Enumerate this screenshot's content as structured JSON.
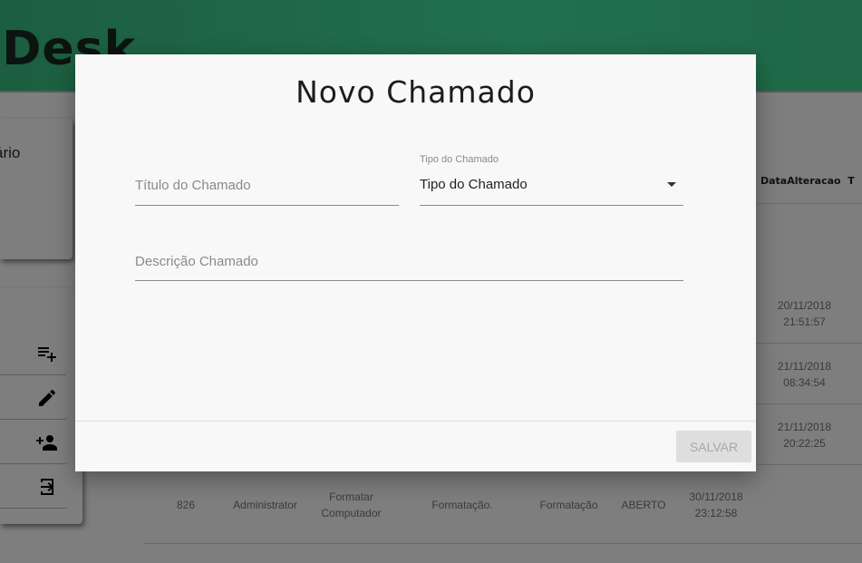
{
  "app": {
    "logo": "eDesk"
  },
  "sidebar": {
    "card_label": "ário",
    "buttons": [
      {
        "icon": "playlist-add-icon"
      },
      {
        "icon": "edit-icon"
      },
      {
        "icon": "person-add-icon"
      },
      {
        "icon": "logout-icon"
      }
    ]
  },
  "table": {
    "header": "DataAlteracao",
    "header_next": "T",
    "dates": [
      [
        "20/11/2018",
        "21:51:57"
      ],
      [
        "21/11/2018",
        "08:34:54"
      ],
      [
        "21/11/2018",
        "20:22:25"
      ]
    ],
    "row": {
      "id": "826",
      "user": "Administrator",
      "title1": "Formatar",
      "title2": "Computador",
      "desc": "Formatação.",
      "type": "Formatação",
      "status": "ABERTO",
      "date1": "30/11/2018",
      "date2": "23:12:58"
    }
  },
  "modal": {
    "title": "Novo Chamado",
    "titulo_placeholder": "Título do Chamado",
    "tipo_label": "Tipo do Chamado",
    "tipo_value": "Tipo do Chamado",
    "descricao_placeholder": "Descrição Chamado",
    "save_label": "SALVAR"
  }
}
